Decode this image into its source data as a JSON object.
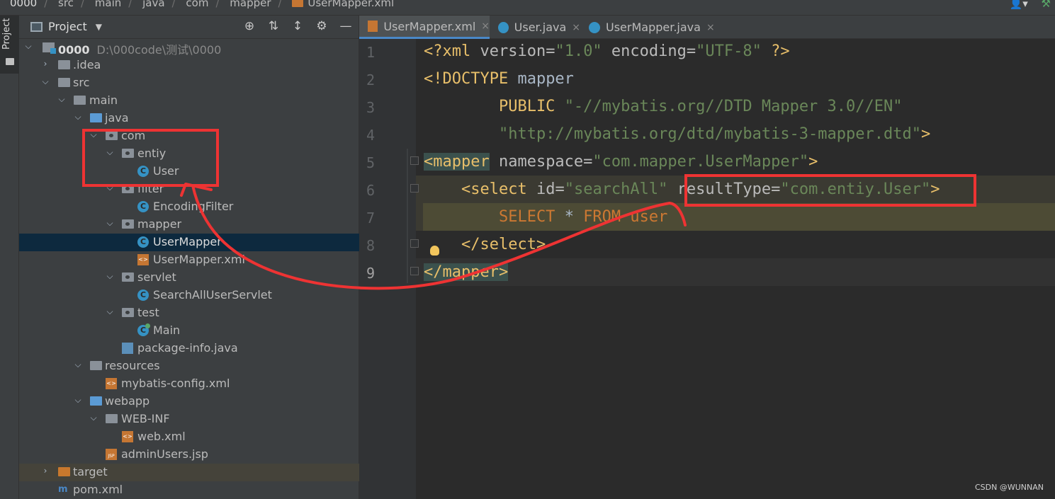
{
  "breadcrumb": {
    "items": [
      "0000",
      "src",
      "main",
      "java",
      "com",
      "mapper",
      "UserMapper.xml"
    ]
  },
  "panel": {
    "title": "Project"
  },
  "tool_strip": {
    "project_label": "Project"
  },
  "tree": {
    "root_name": "0000",
    "root_path": "D:\\000code\\测试\\0000",
    "items": [
      "0000",
      ".idea",
      "src",
      "main",
      "java",
      "com",
      "entiy",
      "User",
      "filter",
      "EncodingFilter",
      "mapper",
      "UserMapper",
      "UserMapper.xml",
      "servlet",
      "SearchAllUserServlet",
      "test",
      "Main",
      "package-info.java",
      "resources",
      "mybatis-config.xml",
      "webapp",
      "WEB-INF",
      "web.xml",
      "adminUsers.jsp",
      "target",
      "pom.xml"
    ]
  },
  "tabs": [
    {
      "label": "UserMapper.xml",
      "close": "×"
    },
    {
      "label": "User.java",
      "close": "×"
    },
    {
      "label": "UserMapper.java",
      "close": "×"
    }
  ],
  "editor": {
    "line_numbers": [
      "1",
      "2",
      "3",
      "4",
      "5",
      "6",
      "7",
      "8",
      "9"
    ],
    "lines": {
      "l1": {
        "a": "<?xml ",
        "b": "version",
        "c": "=",
        "d": "\"1.0\"",
        "e": " encoding",
        "f": "=",
        "g": "\"UTF-8\"",
        "h": " ?>"
      },
      "l2": {
        "a": "<!DOCTYPE ",
        "b": "mapper"
      },
      "l3": {
        "a": "        PUBLIC ",
        "b": "\"-//mybatis.org//DTD Mapper 3.0//EN\""
      },
      "l4": {
        "a": "        \"http://mybatis.org/dtd/mybatis-3-mapper.dtd\"",
        "b": ">"
      },
      "l5": {
        "a": "<mapper",
        "b": " namespace",
        "c": "=",
        "d": "\"com.mapper.UserMapper\"",
        "e": ">"
      },
      "l6": {
        "a": "    <select ",
        "b": "id",
        "c": "=",
        "d": "\"searchAll\"",
        "e": " resultType",
        "f": "=",
        "g": "\"com.entiy.User\"",
        "h": ">"
      },
      "l7": {
        "a": "        SELECT ",
        "b": "* ",
        "c": "FROM ",
        "d": "user"
      },
      "l8": {
        "a": "    </select>"
      },
      "l9": {
        "a": "</mapper>"
      }
    }
  },
  "watermark": "CSDN @WUNNAN",
  "colors": {
    "annotation_red": "#ee3333",
    "xml_tag": "#e8bf6a",
    "xml_string": "#6a8759",
    "keyword": "#cc7832"
  }
}
